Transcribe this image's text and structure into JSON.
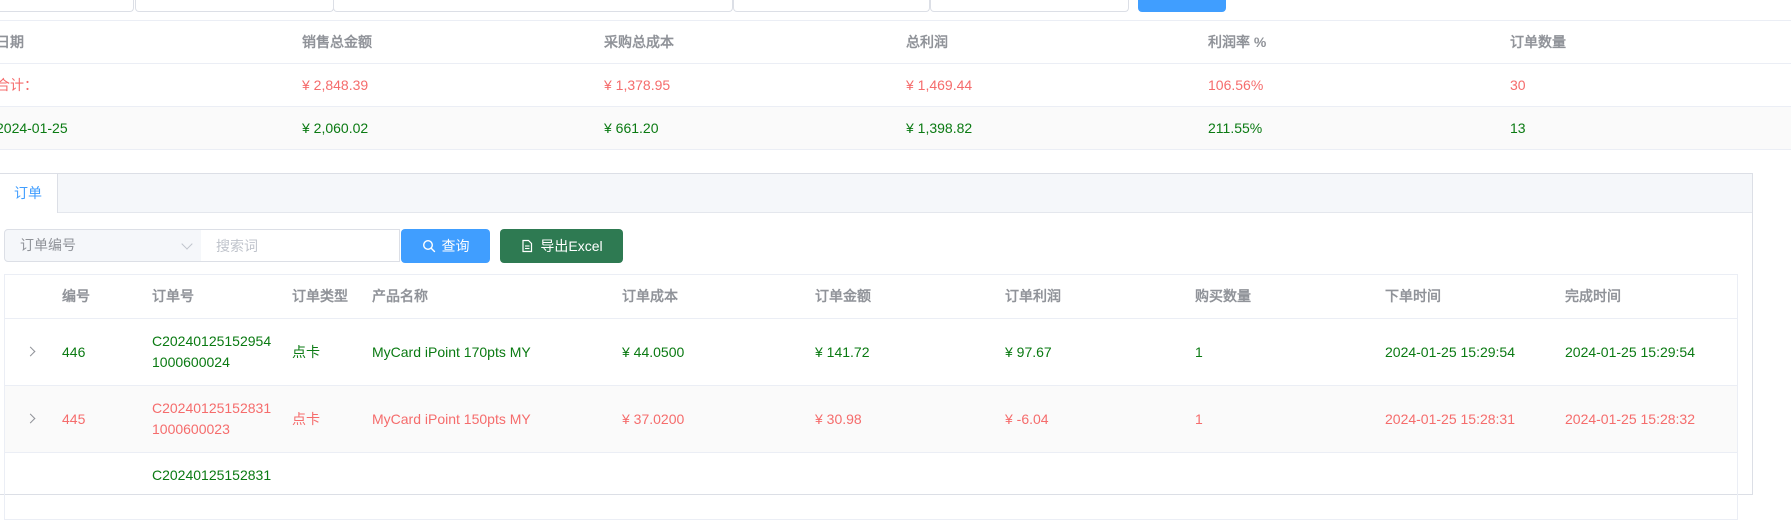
{
  "summary": {
    "headers": [
      "日期",
      "销售总金额",
      "采购总成本",
      "总利润",
      "利润率 %",
      "订单数量"
    ],
    "total_row": [
      "合计：",
      "¥ 2,848.39",
      "¥ 1,378.95",
      "¥ 1,469.44",
      "106.56%",
      "30"
    ],
    "day_row": [
      "2024-01-25",
      "¥ 2,060.02",
      "¥ 661.20",
      "¥ 1,398.82",
      "211.55%",
      "13"
    ]
  },
  "tabs": [
    {
      "label": "订单"
    }
  ],
  "toolbar": {
    "select_value": "订单编号",
    "search_placeholder": "搜索词",
    "query_label": "查询",
    "export_label": "导出Excel"
  },
  "orders": {
    "headers": [
      "编号",
      "订单号",
      "订单类型",
      "产品名称",
      "订单成本",
      "订单金额",
      "订单利润",
      "购买数量",
      "下单时间",
      "完成时间"
    ],
    "rows": [
      {
        "id": "446",
        "order_no_line1": "C20240125152954",
        "order_no_line2": "1000600024",
        "type": "点卡",
        "product": "MyCard iPoint 170pts MY",
        "cost": "¥ 44.0500",
        "amount": "¥ 141.72",
        "profit": "¥ 97.67",
        "qty": "1",
        "order_time": "2024-01-25 15:29:54",
        "finish_time": "2024-01-25 15:29:54",
        "status": "profit"
      },
      {
        "id": "445",
        "order_no_line1": "C20240125152831",
        "order_no_line2": "1000600023",
        "type": "点卡",
        "product": "MyCard iPoint 150pts MY",
        "cost": "¥ 37.0200",
        "amount": "¥ 30.98",
        "profit": "¥ -6.04",
        "qty": "1",
        "order_time": "2024-01-25 15:28:31",
        "finish_time": "2024-01-25 15:28:32",
        "status": "loss"
      },
      {
        "order_no_line1": "C20240125152831",
        "status": "profit"
      }
    ]
  },
  "colors": {
    "primary": "#409eff",
    "export": "#2e7a52",
    "loss": "#f56c6c",
    "profit": "#0a7a12"
  }
}
